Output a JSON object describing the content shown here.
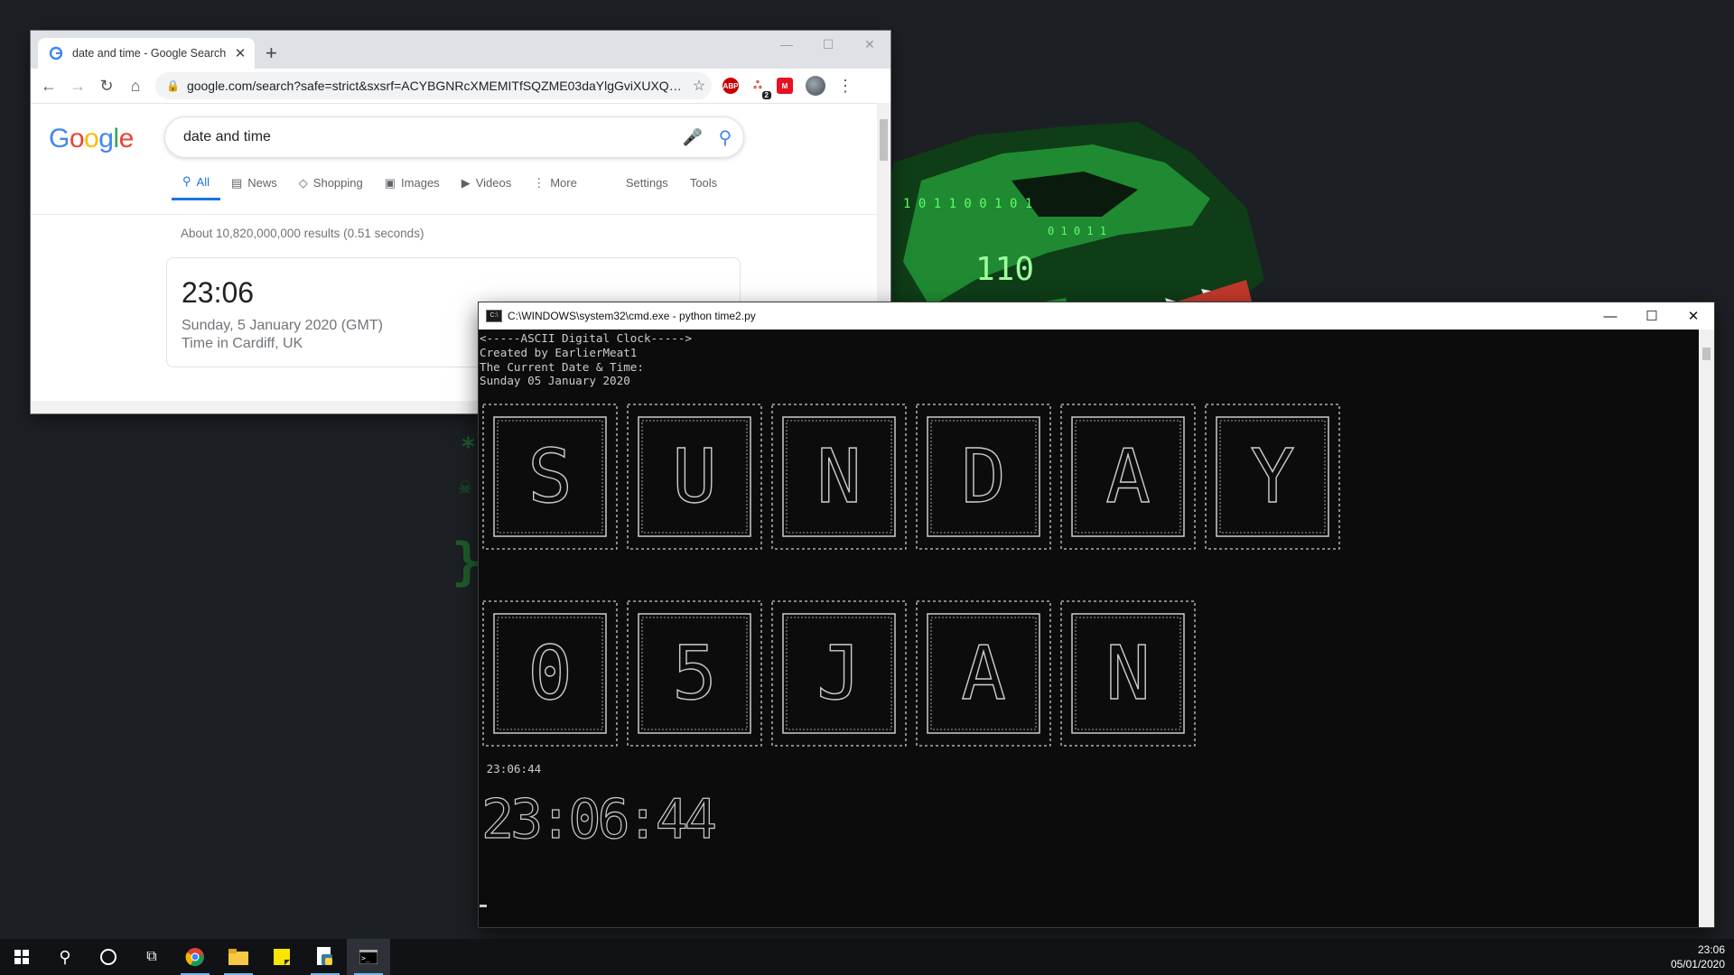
{
  "chrome": {
    "tab_title": "date and time - Google Search",
    "url": "google.com/search?safe=strict&sxsrf=ACYBGNRcXMEMITfSQZME03daYlgGviXUXQ%3A...",
    "extension_badge": "2",
    "search": {
      "logo": "Google",
      "query": "date and time",
      "tabs": [
        "All",
        "News",
        "Shopping",
        "Images",
        "Videos",
        "More",
        "Settings",
        "Tools"
      ],
      "result_stats": "About 10,820,000,000 results (0.51 seconds)",
      "clock_card": {
        "time": "23:06",
        "date": "Sunday, 5 January 2020 (GMT)",
        "place": "Time in Cardiff, UK"
      }
    }
  },
  "cmd": {
    "title": "C:\\WINDOWS\\system32\\cmd.exe - python  time2.py",
    "lines": [
      "<-----ASCII Digital Clock----->",
      "Created by EarlierMeat1",
      "",
      "The Current Date & Time:",
      "Sunday 05 January 2020"
    ],
    "day_blocks": [
      "S",
      "U",
      "N",
      "D",
      "A",
      "Y"
    ],
    "date_blocks": [
      "0",
      "5",
      "J",
      "A",
      "N"
    ],
    "time_text": " 23:06:44"
  },
  "taskbar": {
    "time": "23:06",
    "date": "05/01/2020"
  },
  "colors": {
    "desktop_bg": "#1c2024",
    "google_blue": "#4285f4",
    "console_fg": "#cccccc",
    "matrix_green": "#2ecc40"
  }
}
